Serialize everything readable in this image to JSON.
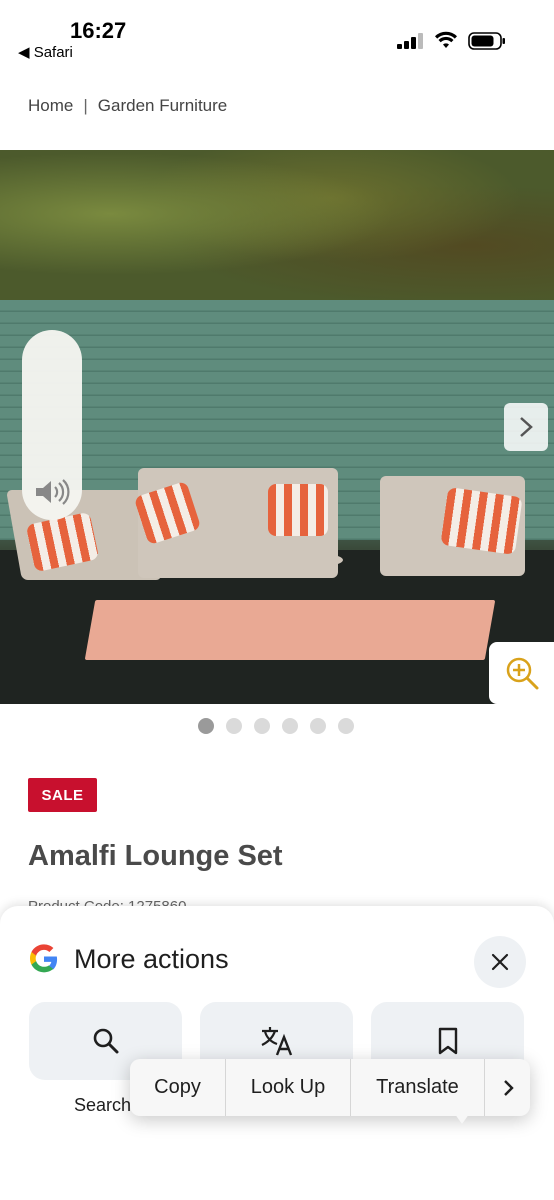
{
  "status_bar": {
    "time": "16:27",
    "back_app": "◀ Safari"
  },
  "breadcrumb": {
    "home": "Home",
    "separator": "|",
    "current": "Garden Furniture"
  },
  "gallery": {
    "image_count": 6,
    "active_index": 0
  },
  "product": {
    "badge": "SALE",
    "title": "Amalfi Lounge Set",
    "code_partial": "Product Code: 1275860"
  },
  "sheet": {
    "title": "More actions",
    "actions": [
      {
        "label": "Search",
        "icon": "search-icon"
      },
      {
        "label": "",
        "icon": "translate-icon"
      },
      {
        "label": "",
        "icon": "bookmark-icon"
      }
    ]
  },
  "context_menu": {
    "items": [
      "Copy",
      "Look Up",
      "Translate"
    ],
    "more_symbol": "›"
  },
  "colors": {
    "sale_red": "#c8102e",
    "sheet_card": "#eef1f4"
  }
}
